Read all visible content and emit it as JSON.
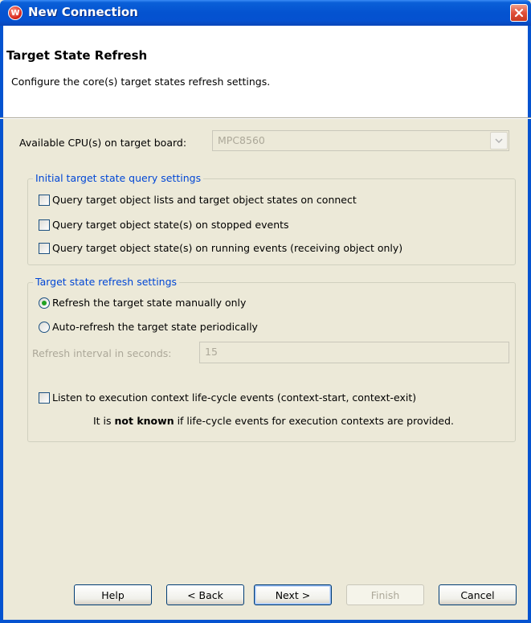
{
  "window": {
    "title": "New Connection",
    "app_icon_glyph": "W"
  },
  "header": {
    "title": "Target State Refresh",
    "description": "Configure the core(s) target states refresh settings."
  },
  "cpu": {
    "label": "Available CPU(s) on target board:",
    "value": "MPC8560"
  },
  "initial_group": {
    "title": "Initial target state query settings",
    "options": [
      {
        "label": "Query target object lists and target object states on connect",
        "checked": false
      },
      {
        "label": "Query target object state(s) on stopped events",
        "checked": false
      },
      {
        "label": "Query target object state(s) on running events (receiving object only)",
        "checked": false
      }
    ]
  },
  "refresh_group": {
    "title": "Target state refresh settings",
    "radio_manual": {
      "label": "Refresh the target state manually only",
      "selected": true
    },
    "radio_auto": {
      "label": "Auto-refresh the target state periodically",
      "selected": false
    },
    "interval_label": "Refresh interval in seconds:",
    "interval_value": "15",
    "listen_label": "Listen to execution context life-cycle events (context-start, context-exit)",
    "listen_checked": false,
    "note_prefix": "It is ",
    "note_bold": "not known",
    "note_suffix": " if life-cycle events for execution contexts are provided."
  },
  "buttons": {
    "help": "Help",
    "back": "< Back",
    "next": "Next >",
    "finish": "Finish",
    "cancel": "Cancel"
  },
  "colors": {
    "titlebar": "#0453d0",
    "group_title": "#0046d5",
    "disabled_text": "#aca899"
  }
}
